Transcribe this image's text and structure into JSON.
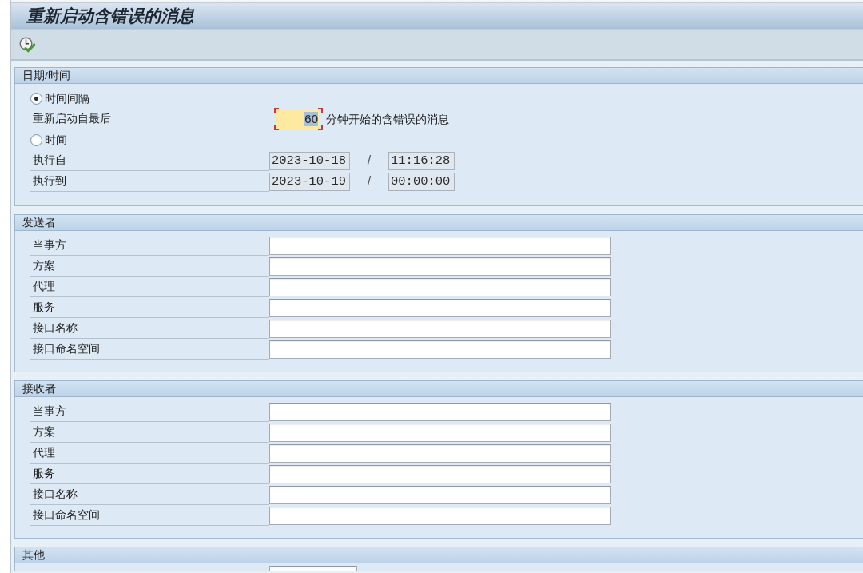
{
  "window": {
    "title": "重新启动含错误的消息"
  },
  "sections": [
    {
      "title": "日期/时间",
      "rows": [
        {
          "kind": "radio",
          "label": "时间间隔",
          "selected": true
        },
        {
          "kind": "interval",
          "label": "重新启动自最后",
          "value": "60",
          "focused": true,
          "suffix": "分钟开始的含错误的消息"
        },
        {
          "kind": "radio",
          "label": "时间",
          "selected": false
        },
        {
          "kind": "datetime",
          "label": "执行自",
          "date": "2023-10-18",
          "separator": "/",
          "time": "11:16:28",
          "disabled": true
        },
        {
          "kind": "datetime",
          "label": "执行到",
          "date": "2023-10-19",
          "separator": "/",
          "time": "00:00:00",
          "disabled": true
        }
      ]
    },
    {
      "title": "发送者",
      "rows": [
        {
          "kind": "text_field",
          "label": "当事方"
        },
        {
          "kind": "text_field",
          "label": "方案"
        },
        {
          "kind": "text_field",
          "label": "代理"
        },
        {
          "kind": "text_field",
          "label": "服务"
        },
        {
          "kind": "text_field",
          "label": "接口名称"
        },
        {
          "kind": "text_field",
          "label": "接口命名空间"
        }
      ]
    },
    {
      "title": "接收者",
      "rows": [
        {
          "kind": "text_field",
          "label": "当事方"
        },
        {
          "kind": "text_field",
          "label": "方案"
        },
        {
          "kind": "text_field",
          "label": "代理"
        },
        {
          "kind": "text_field",
          "label": "服务"
        },
        {
          "kind": "text_field",
          "label": "接口名称"
        },
        {
          "kind": "text_field",
          "label": "接口命名空间"
        }
      ]
    },
    {
      "title": "其他",
      "rows": [
        {
          "kind": "short_field"
        }
      ]
    }
  ]
}
